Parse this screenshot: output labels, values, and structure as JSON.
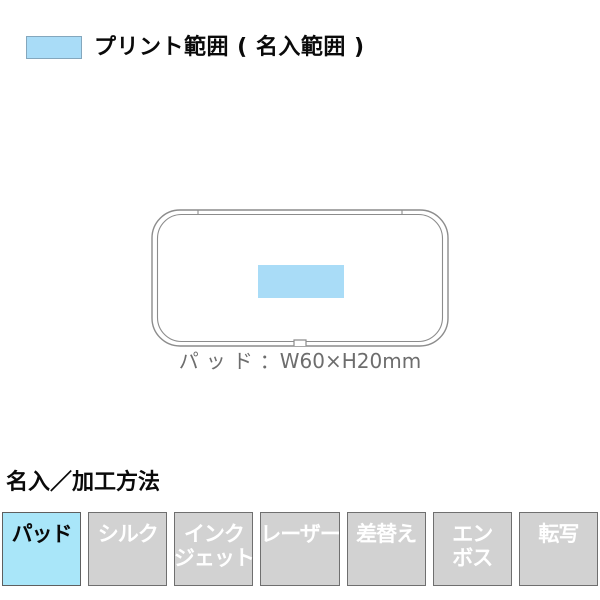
{
  "legend": {
    "swatch_color": "#a9dcf7",
    "swatch_border_color": "#84a7bd",
    "label": "プリント範囲 ( 名入範囲 )"
  },
  "product": {
    "shape_name": "tin-case-outline",
    "outline_color": "#8c8c8c",
    "print_area_color": "#a9dcf7",
    "caption_jp": "パッド",
    "caption_sep": "：",
    "caption_size": "W60×H20mm"
  },
  "methods": {
    "heading": "名入／加工方法",
    "active_color": "#a9e6f9",
    "inactive_color": "#d2d2d2",
    "items": [
      {
        "lines": [
          "パッド"
        ],
        "active": true
      },
      {
        "lines": [
          "シルク"
        ],
        "active": false
      },
      {
        "lines": [
          "インク",
          "ジェット"
        ],
        "active": false
      },
      {
        "lines": [
          "レーザー"
        ],
        "active": false
      },
      {
        "lines": [
          "差替え"
        ],
        "active": false
      },
      {
        "lines": [
          "エン",
          "ボス"
        ],
        "active": false
      },
      {
        "lines": [
          "転写"
        ],
        "active": false
      }
    ]
  }
}
